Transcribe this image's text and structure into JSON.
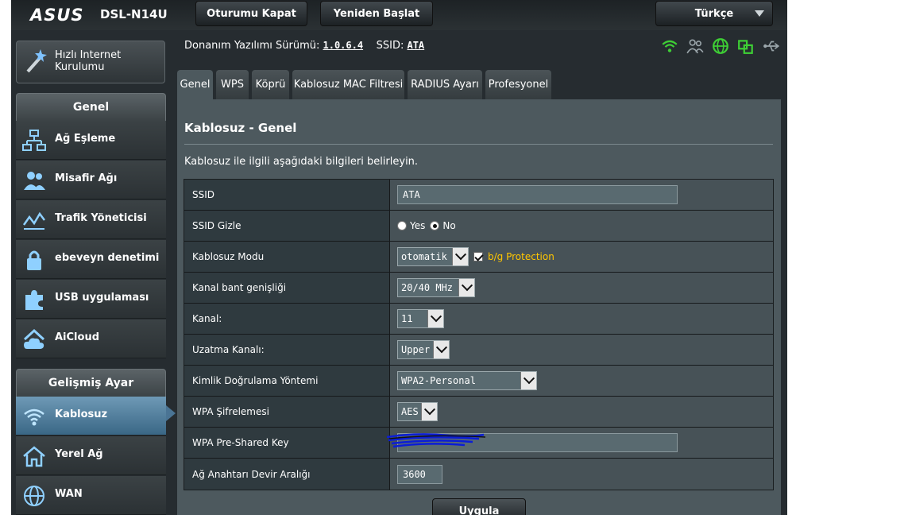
{
  "header": {
    "brand": "ASUS",
    "model": "DSL-N14U",
    "logout_label": "Oturumu Kapat",
    "reboot_label": "Yeniden Başlat",
    "language": "Türkçe"
  },
  "sidebar": {
    "quick_setup": "Hızlı Internet Kurulumu",
    "general_heading": "Genel",
    "general_items": [
      {
        "label": "Ağ Eşleme",
        "icon": "network-map-icon"
      },
      {
        "label": "Misafir Ağı",
        "icon": "guest-network-icon"
      },
      {
        "label": "Trafik Yöneticisi",
        "icon": "traffic-manager-icon"
      },
      {
        "label": "ebeveyn denetimi",
        "icon": "lock-icon"
      },
      {
        "label": "USB uygulaması",
        "icon": "puzzle-icon"
      },
      {
        "label": "AiCloud",
        "icon": "cloud-icon"
      }
    ],
    "advanced_heading": "Gelişmiş Ayar",
    "advanced_items": [
      {
        "label": "Kablosuz",
        "icon": "wifi-icon",
        "active": true
      },
      {
        "label": "Yerel Ağ",
        "icon": "home-icon"
      },
      {
        "label": "WAN",
        "icon": "globe-icon"
      }
    ]
  },
  "infobar": {
    "firmware_label": "Donanım Yazılımı Sürümü:",
    "firmware_value": "1.0.6.4",
    "ssid_label": "SSID:",
    "ssid_value": "ATA"
  },
  "tabs": [
    {
      "label": "Genel",
      "active": true
    },
    {
      "label": "WPS"
    },
    {
      "label": "Köprü"
    },
    {
      "label": "Kablosuz MAC Filtresi"
    },
    {
      "label": "RADIUS Ayarı"
    },
    {
      "label": "Profesyonel"
    }
  ],
  "panel": {
    "title": "Kablosuz - Genel",
    "description": "Kablosuz ile ilgili aşağıdaki bilgileri belirleyin.",
    "apply_label": "Uygula"
  },
  "form": {
    "ssid": {
      "label": "SSID",
      "value": "ATA"
    },
    "ssid_hide": {
      "label": "SSID Gizle",
      "yes": "Yes",
      "no": "No",
      "selected": "No"
    },
    "wireless_mode": {
      "label": "Kablosuz Modu",
      "value": "otomatik",
      "protection_label": "b/g Protection",
      "protection_checked": true
    },
    "bandwidth": {
      "label": "Kanal bant genişliği",
      "value": "20/40 MHz"
    },
    "channel": {
      "label": "Kanal:",
      "value": "11"
    },
    "ext_channel": {
      "label": "Uzatma Kanalı:",
      "value": "Upper"
    },
    "auth_method": {
      "label": "Kimlik Doğrulama Yöntemi",
      "value": "WPA2-Personal"
    },
    "wpa_encryption": {
      "label": "WPA Şifrelemesi",
      "value": "AES"
    },
    "wpa_psk": {
      "label": "WPA Pre-Shared Key",
      "value": ""
    },
    "key_rotation": {
      "label": "Ağ Anahtarı Devir Aralığı",
      "value": "3600"
    }
  },
  "colors": {
    "accent_active": "#4a7494",
    "status_green": "#3ecf35",
    "warning_yellow": "#ffc600"
  }
}
